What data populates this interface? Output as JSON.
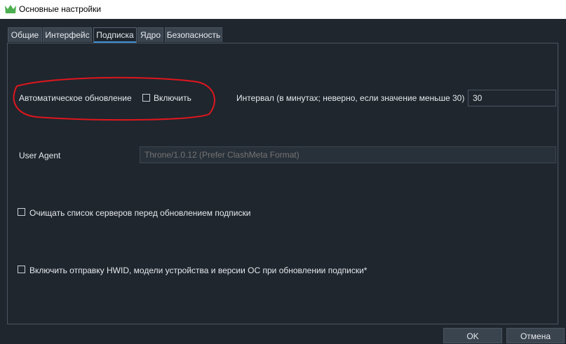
{
  "window": {
    "title": "Основные настройки",
    "icon": "app-icon"
  },
  "tabs": [
    {
      "label": "Общие",
      "active": false
    },
    {
      "label": "Интерфейс",
      "active": false
    },
    {
      "label": "Подписка",
      "active": true
    },
    {
      "label": "Ядро",
      "active": false
    },
    {
      "label": "Безопасность",
      "active": false
    }
  ],
  "subscription": {
    "auto_update": {
      "label": "Автоматическое обновление",
      "enable_checkbox": {
        "label": "Включить",
        "checked": false
      }
    },
    "interval": {
      "label": "Интервал (в минутах; неверно, если значение меньше 30)",
      "value": "30"
    },
    "user_agent": {
      "label": "User Agent",
      "placeholder": "Throne/1.0.12 (Prefer ClashMeta Format)"
    },
    "clear_servers": {
      "label": "Очищать список серверов перед обновлением подписки",
      "checked": false
    },
    "send_hwid": {
      "label": "Включить отправку HWID, модели устройства и версии ОС при обновлении подписки*",
      "checked": false
    }
  },
  "buttons": {
    "ok": "OK",
    "cancel": "Отмена"
  },
  "colors": {
    "accent": "#3a8fd6",
    "annotation": "#e0161d",
    "background": "#1f262e"
  }
}
